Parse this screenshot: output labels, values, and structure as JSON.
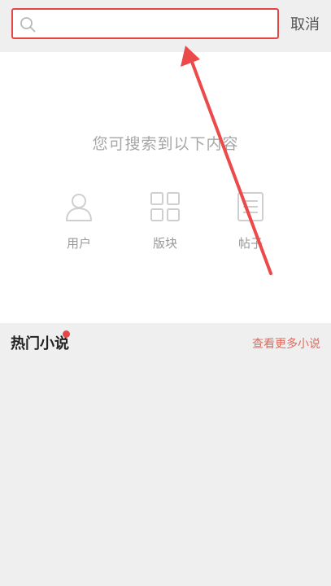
{
  "search": {
    "value": "",
    "placeholder": "",
    "cancel_label": "取消"
  },
  "panel": {
    "hint": "您可搜索到以下内容",
    "categories": [
      {
        "label": "用户",
        "icon": "user-icon"
      },
      {
        "label": "版块",
        "icon": "grid-icon"
      },
      {
        "label": "帖子",
        "icon": "document-icon"
      }
    ]
  },
  "hot": {
    "title": "热门小说",
    "more_label": "查看更多小说"
  },
  "colors": {
    "accent": "#e64545",
    "link": "#e06a5e",
    "background": "#efefef"
  }
}
